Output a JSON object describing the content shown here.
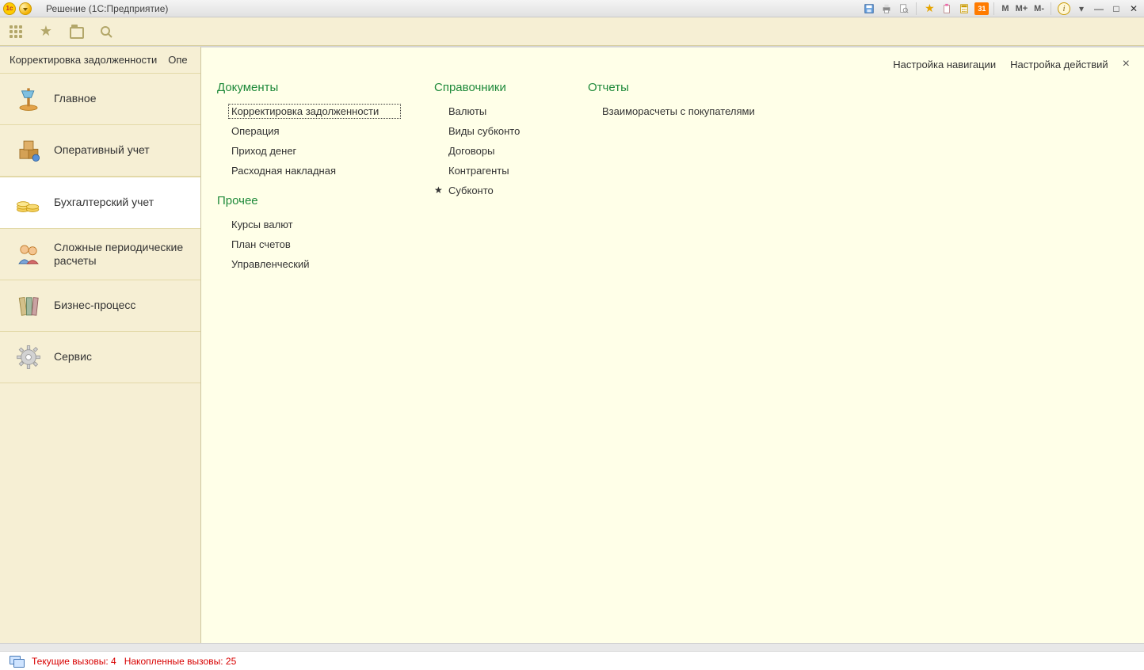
{
  "titlebar": {
    "app_title": "Решение  (1С:Предприятие)",
    "memory_buttons": [
      "M",
      "M+",
      "M-"
    ],
    "calendar_day": "31"
  },
  "toolbar_tabs": {
    "tab1": "Корректировка задолженности",
    "tab2": "Опе"
  },
  "sidebar": {
    "items": [
      {
        "label": "Главное"
      },
      {
        "label": "Оперативный учет"
      },
      {
        "label": "Бухгалтерский учет"
      },
      {
        "label": "Сложные периодические расчеты"
      },
      {
        "label": "Бизнес-процесс"
      },
      {
        "label": "Сервис"
      }
    ]
  },
  "content": {
    "top_links": {
      "nav_settings": "Настройка навигации",
      "action_settings": "Настройка действий"
    },
    "columns": {
      "documents": {
        "title": "Документы",
        "items": [
          "Корректировка задолженности",
          "Операция",
          "Приход денег",
          "Расходная накладная"
        ]
      },
      "other": {
        "title": "Прочее",
        "items": [
          "Курсы валют",
          "План счетов",
          "Управленческий"
        ]
      },
      "dictionaries": {
        "title": "Справочники",
        "items": [
          "Валюты",
          "Виды субконто",
          "Договоры",
          "Контрагенты",
          "Субконто"
        ]
      },
      "reports": {
        "title": "Отчеты",
        "items": [
          "Взаиморасчеты с покупателями"
        ]
      }
    }
  },
  "statusbar": {
    "current_calls_label": "Текущие вызовы:",
    "current_calls_value": "4",
    "accumulated_calls_label": "Накопленные вызовы:",
    "accumulated_calls_value": "25"
  }
}
